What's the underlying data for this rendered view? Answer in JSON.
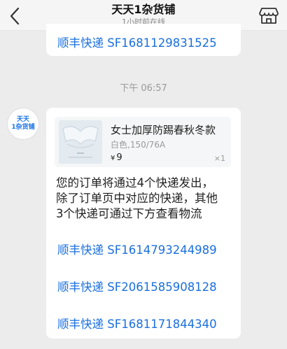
{
  "header": {
    "title": "天天1杂货铺",
    "subtitle": "1小时前在线"
  },
  "top_message": {
    "link": "顺丰快递 SF1681129831525"
  },
  "timestamp": "下午 06:57",
  "avatar": {
    "line1": "天天",
    "line2": "1杂货铺"
  },
  "product": {
    "name": "女士加厚防踢春秋冬款",
    "sku": "白色,150/76A",
    "currency": "¥",
    "price": "9",
    "quantity": "×1"
  },
  "message": {
    "lines": [
      "您的订单将通过4个快递发出，",
      "除了订单页中对应的快递，其他",
      "3个快递可通过下方查看物流"
    ],
    "links": [
      "顺丰快递 SF1614793244989",
      "顺丰快递 SF2061585908128",
      "顺丰快递 SF1681171844340"
    ]
  },
  "colors": {
    "link": "#1a6fe0",
    "background": "#ececec",
    "bubble": "#ffffff"
  }
}
